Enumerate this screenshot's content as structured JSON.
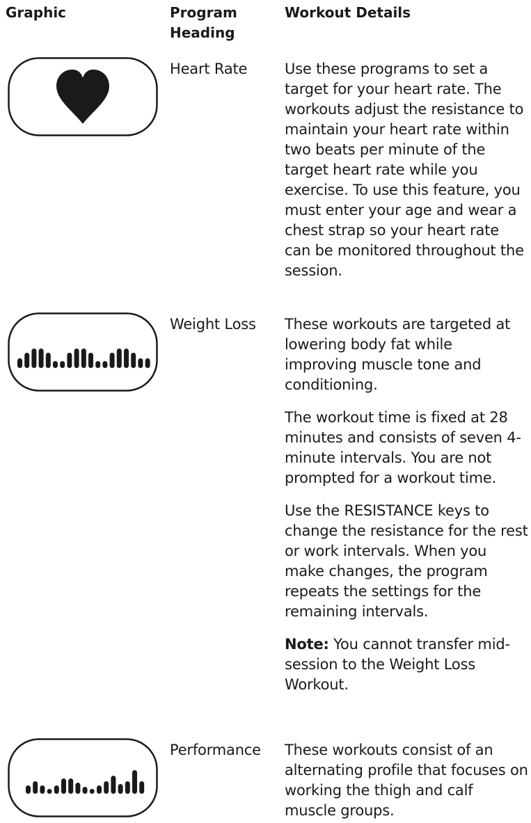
{
  "headers": {
    "graphic": "Graphic",
    "program_heading": "Program\nHeading",
    "workout_details": "Workout Details"
  },
  "rows": [
    {
      "icon": "heart-icon",
      "heading": "Heart Rate",
      "paragraphs": [
        "Use these programs to set a target for your heart rate. The workouts adjust the resistance to maintain your heart rate within two beats per minute of the target heart rate while you exercise. To use this feature, you must enter your age and wear a chest strap so your heart rate can be monitored throughout the session."
      ]
    },
    {
      "icon": "weight-loss-profile-icon",
      "heading": "Weight Loss",
      "paragraphs": [
        "These workouts are targeted at lowering body fat while improving muscle tone and conditioning.",
        "The workout time is fixed at 28 minutes and consists of seven 4-minute intervals. You are not prompted for a workout time.",
        "Use the RESISTANCE keys to change the resistance for the rest or work intervals. When you make changes, the program repeats the settings for the remaining intervals."
      ],
      "note_label": "Note:",
      "note_text": " You cannot transfer mid-session to the Weight Loss Workout."
    },
    {
      "icon": "performance-profile-icon",
      "heading": "Performance",
      "paragraphs": [
        "These workouts consist of an alternating profile that focuses on working the thigh and calf muscle groups."
      ]
    }
  ],
  "colors": {
    "ink": "#1a1a1a",
    "background": "#ffffff"
  }
}
